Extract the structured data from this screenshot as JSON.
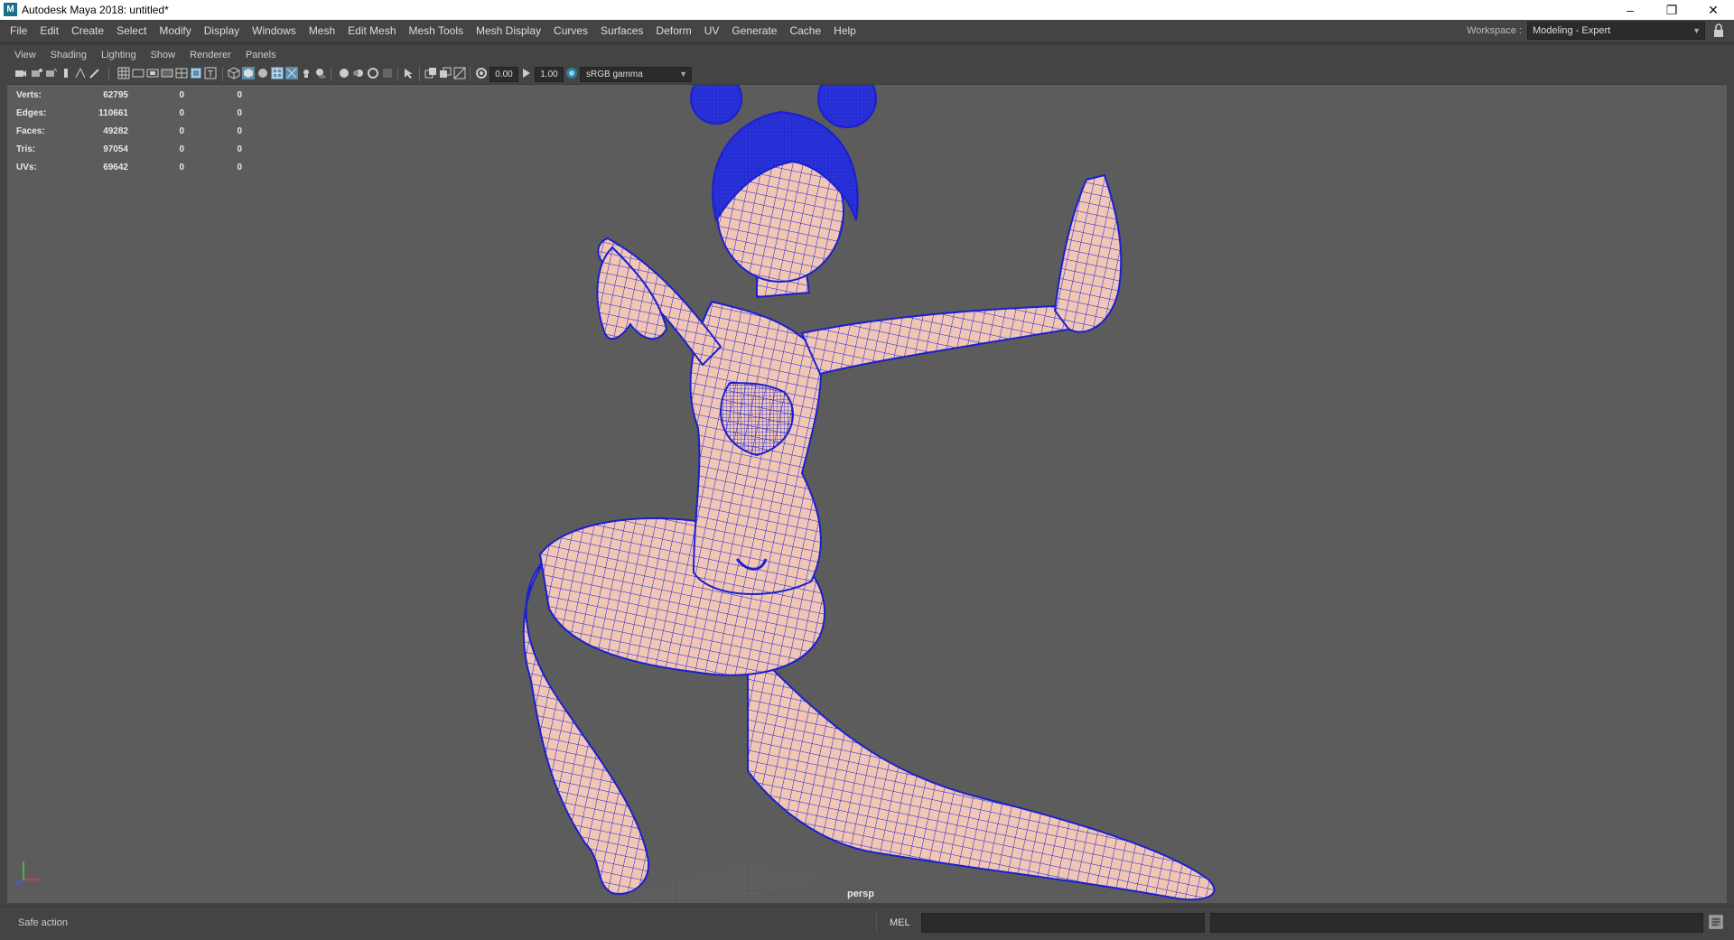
{
  "window": {
    "title": "Autodesk Maya 2018: untitled*",
    "app_icon": "maya-icon",
    "app_icon_letter": "M",
    "minimize": "–",
    "restore": "❐",
    "close": "✕"
  },
  "main_menu": {
    "items": [
      "File",
      "Edit",
      "Create",
      "Select",
      "Modify",
      "Display",
      "Windows",
      "Mesh",
      "Edit Mesh",
      "Mesh Tools",
      "Mesh Display",
      "Curves",
      "Surfaces",
      "Deform",
      "UV",
      "Generate",
      "Cache",
      "Help"
    ]
  },
  "workspace": {
    "label": "Workspace :",
    "value": "Modeling - Expert"
  },
  "panel_menu": {
    "items": [
      "View",
      "Shading",
      "Lighting",
      "Show",
      "Renderer",
      "Panels"
    ]
  },
  "panel_toolbar": {
    "exposure": "0.00",
    "gamma": "1.00",
    "color_space": "sRGB gamma"
  },
  "hud": {
    "rows": [
      {
        "label": "Verts:",
        "v1": "62795",
        "v2": "0",
        "v3": "0"
      },
      {
        "label": "Edges:",
        "v1": "110661",
        "v2": "0",
        "v3": "0"
      },
      {
        "label": "Faces:",
        "v1": "49282",
        "v2": "0",
        "v3": "0"
      },
      {
        "label": "Tris:",
        "v1": "97054",
        "v2": "0",
        "v3": "0"
      },
      {
        "label": "UVs:",
        "v1": "69642",
        "v2": "0",
        "v3": "0"
      }
    ]
  },
  "viewport": {
    "camera": "persp",
    "background_color": "#5c5c5c",
    "mesh_color": "#f2c6b4",
    "wire_color": "#1a1fd0"
  },
  "command_line": {
    "status": "Safe action",
    "language": "MEL"
  }
}
